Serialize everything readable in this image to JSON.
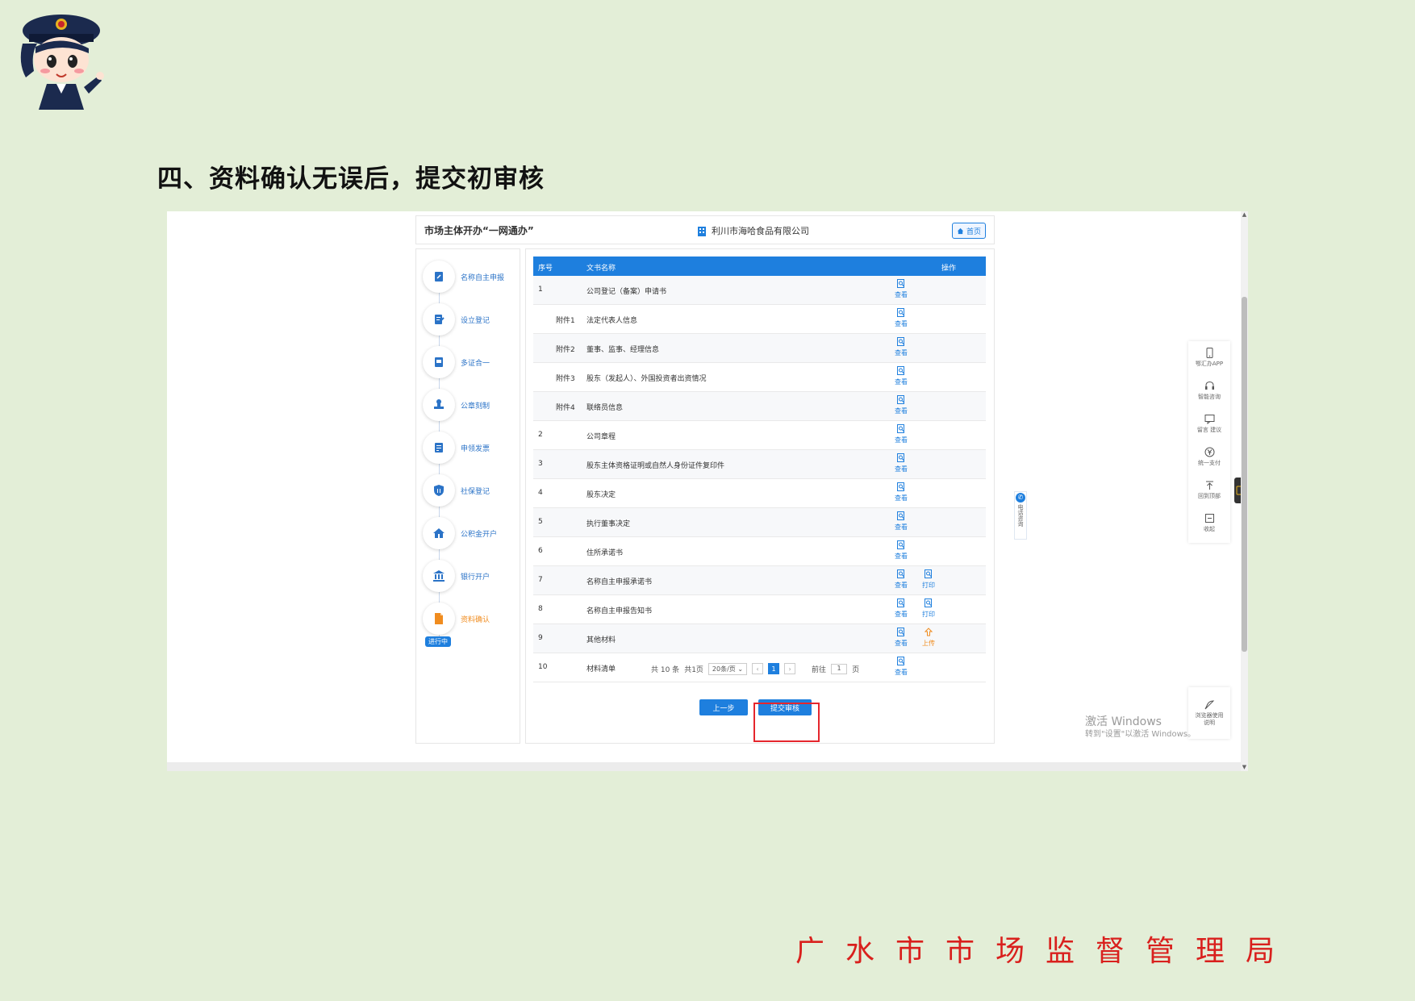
{
  "heading": "四、资料确认无误后，提交初审核",
  "footer_org": "广水市市场监督管理局",
  "app": {
    "system_title": "市场主体开办“一网通办”",
    "company_name": "利川市海哈食品有限公司",
    "home_label": "首页"
  },
  "steps": [
    {
      "label": "名称自主申报",
      "icon": "edit-doc-icon"
    },
    {
      "label": "设立登记",
      "icon": "pen-doc-icon"
    },
    {
      "label": "多证合一",
      "icon": "card-icon"
    },
    {
      "label": "公章刻制",
      "icon": "stamp-icon"
    },
    {
      "label": "申领发票",
      "icon": "invoice-icon"
    },
    {
      "label": "社保登记",
      "icon": "shield-icon"
    },
    {
      "label": "公积金开户",
      "icon": "house-icon"
    },
    {
      "label": "银行开户",
      "icon": "bank-icon"
    },
    {
      "label": "资料确认",
      "icon": "file-icon",
      "badge": "进行中"
    }
  ],
  "table": {
    "headers": {
      "seq": "序号",
      "name": "文书名称",
      "ops": "操作"
    },
    "rows": [
      {
        "seq": "1",
        "name": "公司登记（备案）申请书",
        "ops": [
          "查看"
        ]
      },
      {
        "seq": "附件1",
        "name": "法定代表人信息",
        "ops": [
          "查看"
        ]
      },
      {
        "seq": "附件2",
        "name": "董事、监事、经理信息",
        "ops": [
          "查看"
        ]
      },
      {
        "seq": "附件3",
        "name": "股东（发起人）、外国投资者出资情况",
        "ops": [
          "查看"
        ]
      },
      {
        "seq": "附件4",
        "name": "联络员信息",
        "ops": [
          "查看"
        ]
      },
      {
        "seq": "2",
        "name": "公司章程",
        "ops": [
          "查看"
        ]
      },
      {
        "seq": "3",
        "name": "股东主体资格证明或自然人身份证件复印件",
        "ops": [
          "查看"
        ]
      },
      {
        "seq": "4",
        "name": "股东决定",
        "ops": [
          "查看"
        ]
      },
      {
        "seq": "5",
        "name": "执行董事决定",
        "ops": [
          "查看"
        ]
      },
      {
        "seq": "6",
        "name": "住所承诺书",
        "ops": [
          "查看"
        ]
      },
      {
        "seq": "7",
        "name": "名称自主申报承诺书",
        "ops": [
          "查看",
          "打印"
        ]
      },
      {
        "seq": "8",
        "name": "名称自主申报告知书",
        "ops": [
          "查看",
          "打印"
        ]
      },
      {
        "seq": "9",
        "name": "其他材料",
        "ops": [
          "查看",
          "上传"
        ]
      },
      {
        "seq": "10",
        "name": "材料清单",
        "ops": [
          "查看"
        ]
      }
    ]
  },
  "pager": {
    "total": "共 10 条",
    "pages": "共1页",
    "page_size": "20条/页",
    "current": "1",
    "goto_label": "前往",
    "goto_value": "1",
    "page_unit": "页"
  },
  "buttons": {
    "prev": "上一步",
    "submit": "提交审核"
  },
  "phone_float": "电话咨询",
  "right_tools": [
    {
      "label": "鄂汇办APP",
      "icon": "phone-icon"
    },
    {
      "label": "智能咨询",
      "icon": "headset-icon"
    },
    {
      "label": "留言 建议",
      "icon": "message-icon"
    },
    {
      "label": "统一支付",
      "icon": "yuan-icon"
    },
    {
      "label": "回到顶部",
      "icon": "top-icon"
    },
    {
      "label": "收起",
      "icon": "collapse-icon"
    }
  ],
  "guide_tool": "浏览器使用说明",
  "watermark": {
    "line1": "激活 Windows",
    "line2": "转到\"设置\"以激活 Windows。"
  },
  "colors": {
    "background": "#e3eed7",
    "accent": "#1e7fde",
    "active_step": "#f08c1f",
    "footer_text": "#d9201d",
    "highlight_box": "#e5262d"
  }
}
